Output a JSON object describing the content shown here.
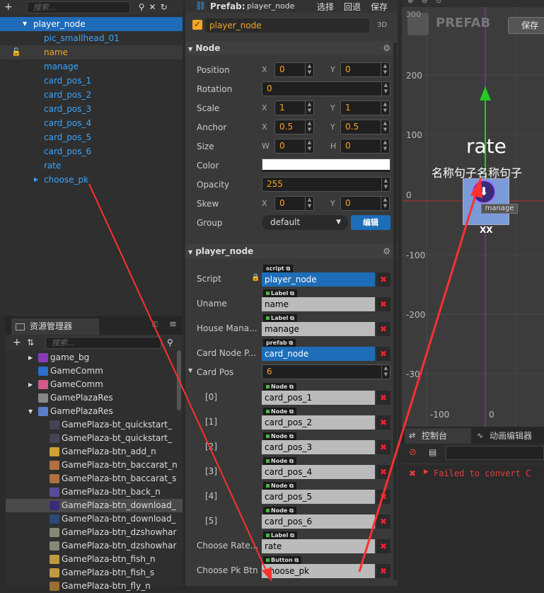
{
  "hierarchy": {
    "search_placeholder": "搜索...",
    "items": [
      {
        "label": "player_node"
      },
      {
        "label": "pic_smallhead_01"
      },
      {
        "label": "name"
      },
      {
        "label": "manage"
      },
      {
        "label": "card_pos_1"
      },
      {
        "label": "card_pos_2"
      },
      {
        "label": "card_pos_3"
      },
      {
        "label": "card_pos_4"
      },
      {
        "label": "card_pos_5"
      },
      {
        "label": "card_pos_6"
      },
      {
        "label": "rate"
      },
      {
        "label": "choose_pk"
      }
    ]
  },
  "assets": {
    "tab_label": "资源管理器",
    "search_placeholder": "搜索...",
    "items": [
      {
        "label": "game_bg"
      },
      {
        "label": "GameComm"
      },
      {
        "label": "GameComm"
      },
      {
        "label": "GamePlazaRes"
      },
      {
        "label": "GamePlazaRes"
      },
      {
        "label": "GamePlaza-bt_quickstart_"
      },
      {
        "label": "GamePlaza-bt_quickstart_"
      },
      {
        "label": "GamePlaza-btn_add_n"
      },
      {
        "label": "GamePlaza-btn_baccarat_n"
      },
      {
        "label": "GamePlaza-btn_baccarat_s"
      },
      {
        "label": "GamePlaza-btn_back_n"
      },
      {
        "label": "GamePlaza-btn_download_"
      },
      {
        "label": "GamePlaza-btn_download_"
      },
      {
        "label": "GamePlaza-btn_dzshowhar"
      },
      {
        "label": "GamePlaza-btn_dzshowhar"
      },
      {
        "label": "GamePlaza-btn_fish_n"
      },
      {
        "label": "GamePlaza-btn_fish_s"
      },
      {
        "label": "GamePlaza-btn_fly_n"
      }
    ]
  },
  "inspector": {
    "prefab_label": "Prefab:",
    "prefab_name": "player_node",
    "actions": {
      "select": "选择",
      "revert": "回退",
      "save": "保存"
    },
    "node_name": "player_node",
    "label_3d": "3D",
    "node_section": "Node",
    "props": {
      "position": {
        "label": "Position",
        "x": "0",
        "y": "0"
      },
      "rotation": {
        "label": "Rotation",
        "value": "0"
      },
      "scale": {
        "label": "Scale",
        "x": "1",
        "y": "1"
      },
      "anchor": {
        "label": "Anchor",
        "x": "0.5",
        "y": "0.5"
      },
      "size": {
        "label": "Size",
        "w": "0",
        "h": "0"
      },
      "color": {
        "label": "Color"
      },
      "opacity": {
        "label": "Opacity",
        "value": "255"
      },
      "skew": {
        "label": "Skew",
        "x": "0",
        "y": "0"
      },
      "group": {
        "label": "Group",
        "value": "default",
        "edit": "编辑"
      }
    },
    "axis": {
      "x": "X",
      "y": "Y",
      "w": "W",
      "h": "H"
    },
    "component_section": "player_node",
    "fields": {
      "script": {
        "label": "Script",
        "tag": "script",
        "value": "player_node"
      },
      "uname": {
        "label": "Uname",
        "tag": "Label",
        "value": "name"
      },
      "house": {
        "label": "House Mana...",
        "tag": "Label",
        "value": "manage"
      },
      "cardnode": {
        "label": "Card Node P...",
        "tag": "prefab",
        "value": "card_node"
      },
      "cardpos": {
        "label": "Card Pos",
        "value": "6"
      },
      "choose_rate": {
        "label": "Choose Rate...",
        "tag": "Label",
        "value": "rate"
      },
      "choose_pk": {
        "label": "Choose Pk Btn",
        "tag": "Button",
        "value": "choose_pk"
      }
    },
    "card_pos_items": [
      {
        "index": "[0]",
        "tag": "Node",
        "value": "card_pos_1"
      },
      {
        "index": "[1]",
        "tag": "Node",
        "value": "card_pos_2"
      },
      {
        "index": "[2]",
        "tag": "Node",
        "value": "card_pos_3"
      },
      {
        "index": "[3]",
        "tag": "Node",
        "value": "card_pos_4"
      },
      {
        "index": "[4]",
        "tag": "Node",
        "value": "card_pos_5"
      },
      {
        "index": "[5]",
        "tag": "Node",
        "value": "card_pos_6"
      }
    ],
    "remove_glyph": "✖"
  },
  "scene": {
    "watermark": "PREFAB",
    "save": "保存",
    "rate_text": "rate",
    "name_text": "名称句子名称句子",
    "manage_text": "manage",
    "xx_text": "XX",
    "ruler_y": [
      "200",
      "100",
      "0",
      "-100",
      "-200",
      "-30"
    ],
    "ruler_x": [
      "-100",
      "0"
    ],
    "top_y": "300"
  },
  "console": {
    "tab_console": "控制台",
    "tab_anim": "动画编辑器",
    "error_text": "Failed to convert C"
  },
  "colors": {
    "accent": "#1e6bb8",
    "value": "#f5a623",
    "link": "#39a5ff",
    "error": "#e23d3d"
  }
}
